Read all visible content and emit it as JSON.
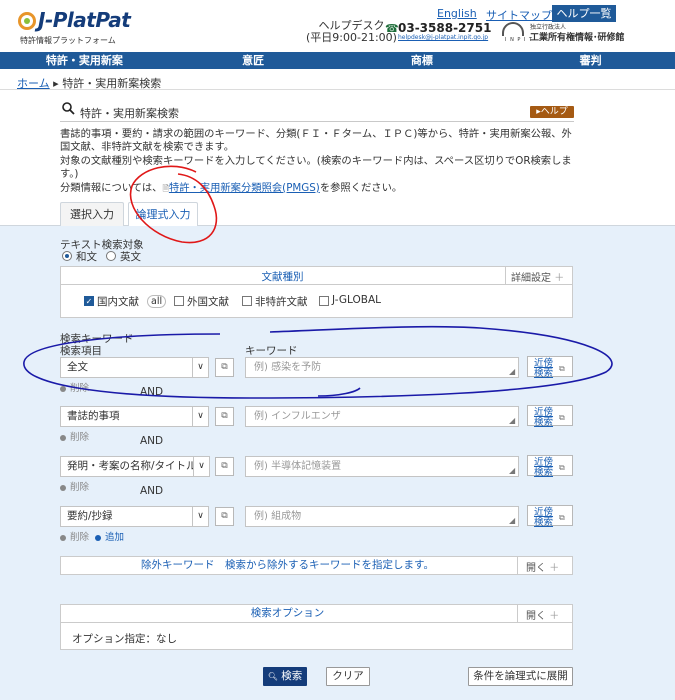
{
  "header": {
    "logo_text": "J-PlatPat",
    "logo_subtitle": "特許情報プラットフォーム",
    "links": {
      "english": "English",
      "sitemap": "サイトマップ"
    },
    "help_list": "ヘルプ一覧",
    "helpdesk_label": "ヘルプデスク",
    "helpdesk_hours": "(平日9:00-21:00)",
    "phone": "03-3588-2751",
    "email": "helpdesk@j-platpat.inpit.go.jp",
    "org_small": "独立行政法人",
    "org_name": "工業所有権情報･研修館",
    "org_tag": "I N P I T"
  },
  "nav": [
    "特許・実用新案",
    "意匠",
    "商標",
    "審判"
  ],
  "breadcrumb": {
    "home": "ホーム",
    "current": "特許・実用新案検索"
  },
  "page": {
    "title": "特許・実用新案検索",
    "help_button": "▸ヘルプ",
    "description": [
      "書誌的事項・要約・請求の範囲のキーワード、分類(ＦＩ・Ｆターム、ＩＰＣ)等から、特許・実用新案公報、外国文献、非特許文献を検索できます。",
      "対象の文献種別や検索キーワードを入力してください。(検索のキーワード内は、スペース区切りでOR検索します。)"
    ],
    "classification_prefix": "分類情報については、",
    "classification_link": "特許・実用新案分類照会(PMGS)",
    "classification_suffix": "を参照ください。"
  },
  "tabs": [
    "選択入力",
    "論理式入力"
  ],
  "text_target": {
    "label": "テキスト検索対象",
    "options": [
      "和文",
      "英文"
    ],
    "selected": "和文"
  },
  "doc_types": {
    "header": "文献種別",
    "detail_button": "詳細設定",
    "items": [
      {
        "label": "国内文献",
        "checked": true,
        "badge": "all"
      },
      {
        "label": "外国文献",
        "checked": false
      },
      {
        "label": "非特許文献",
        "checked": false
      },
      {
        "label": "J-GLOBAL",
        "checked": false
      }
    ]
  },
  "keywords": {
    "section_label": "検索キーワード",
    "field_label": "検索項目",
    "keyword_label": "キーワード",
    "synonym_button": [
      "近傍",
      "検索"
    ],
    "delete_label": "削除",
    "add_label": "追加",
    "and_label": "AND",
    "rows": [
      {
        "field": "全文",
        "placeholder": "例) 感染を予防"
      },
      {
        "field": "書誌的事項",
        "placeholder": "例) インフルエンザ"
      },
      {
        "field": "発明・考案の名称/タイトル",
        "placeholder": "例) 半導体記憶装置"
      },
      {
        "field": "要約/抄録",
        "placeholder": "例) 組成物"
      }
    ]
  },
  "exclude": {
    "label": "除外キーワード　検索から除外するキーワードを指定します。",
    "open": "開く"
  },
  "options": {
    "label": "検索オプション",
    "open": "開く",
    "current": "オプション指定：なし"
  },
  "actions": {
    "search": "検索",
    "clear": "クリア",
    "expand": "条件を論理式に展開"
  },
  "annotation_colors": {
    "red_circle": "#e01818",
    "blue_ellipse": "#1a1aa8"
  }
}
